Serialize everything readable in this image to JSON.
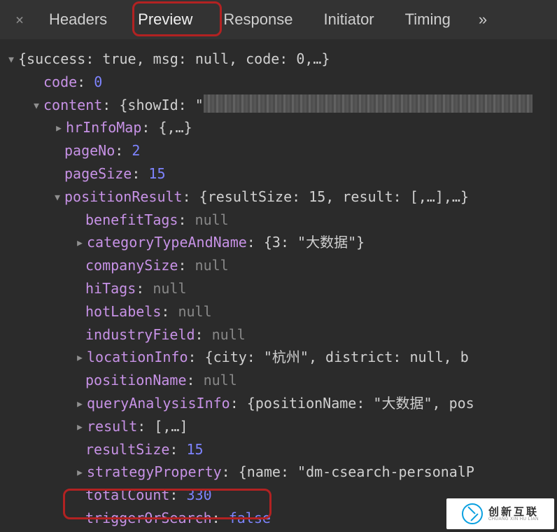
{
  "tabs": {
    "close": "×",
    "headers": "Headers",
    "preview": "Preview",
    "response": "Response",
    "initiator": "Initiator",
    "timing": "Timing",
    "more": "»"
  },
  "json": {
    "rootSummary": "{success: true, msg: null, code: 0,…}",
    "code": {
      "key": "code",
      "value": "0"
    },
    "content": {
      "key": "content",
      "summaryPrefix": "{showId: \"",
      "hrInfoMap": {
        "key": "hrInfoMap",
        "summary": "{,…}"
      },
      "pageNo": {
        "key": "pageNo",
        "value": "2"
      },
      "pageSize": {
        "key": "pageSize",
        "value": "15"
      },
      "positionResult": {
        "key": "positionResult",
        "summary": "{resultSize: 15, result: [,…],…}",
        "benefitTags": {
          "key": "benefitTags",
          "value": "null"
        },
        "categoryTypeAndName": {
          "key": "categoryTypeAndName",
          "summary": "{3: \"大数据\"}"
        },
        "companySize": {
          "key": "companySize",
          "value": "null"
        },
        "hiTags": {
          "key": "hiTags",
          "value": "null"
        },
        "hotLabels": {
          "key": "hotLabels",
          "value": "null"
        },
        "industryField": {
          "key": "industryField",
          "value": "null"
        },
        "locationInfo": {
          "key": "locationInfo",
          "summary": "{city: \"杭州\", district: null, b"
        },
        "positionName": {
          "key": "positionName",
          "value": "null"
        },
        "queryAnalysisInfo": {
          "key": "queryAnalysisInfo",
          "summary": "{positionName: \"大数据\", pos"
        },
        "result": {
          "key": "result",
          "summary": "[,…]"
        },
        "resultSize": {
          "key": "resultSize",
          "value": "15"
        },
        "strategyProperty": {
          "key": "strategyProperty",
          "summary": "{name: \"dm-csearch-personalP"
        },
        "totalCount": {
          "key": "totalCount",
          "value": "330"
        },
        "triggerOrSearch": {
          "key": "triggerOrSearch",
          "value": "false"
        }
      }
    }
  },
  "watermark": {
    "cn": "创新互联",
    "en": "CHUANG XIN HU LIAN"
  }
}
